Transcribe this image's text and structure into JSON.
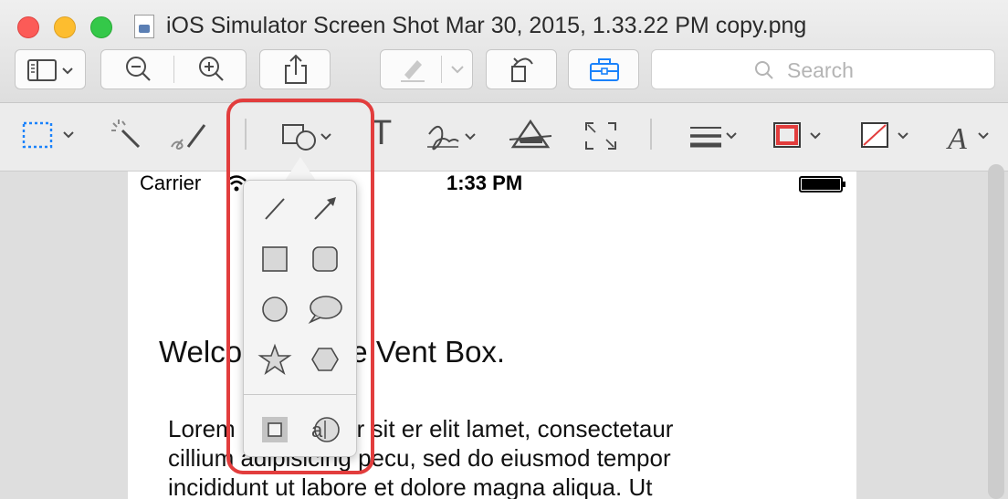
{
  "window": {
    "title": "iOS Simulator Screen Shot Mar 30, 2015, 1.33.22 PM copy.png"
  },
  "toolbar": {
    "search_placeholder": "Search",
    "items": [
      "sidebar-view",
      "zoom-out",
      "zoom-in",
      "share",
      "markup-toggle",
      "rotate",
      "toolbox"
    ]
  },
  "markup_toolbar": {
    "tools": [
      "rectangular-selection",
      "instant-alpha",
      "sketch",
      "shapes",
      "text",
      "sign",
      "adjust-color",
      "adjust-size",
      "shape-style",
      "border-color",
      "fill-color",
      "text-style"
    ],
    "text_tool_label": "T"
  },
  "shapes_popover": {
    "items": [
      "line",
      "arrow",
      "square",
      "rounded-square",
      "circle",
      "speech-bubble",
      "star",
      "hexagon",
      "mask",
      "loupe"
    ]
  },
  "document": {
    "status_bar": {
      "carrier": "Carrier",
      "time": "1:33 PM"
    },
    "heading": "Welcome to the Vent Box.",
    "body_lines": [
      "Lorem ipsum dolor sit er elit lamet, consectetaur",
      "cillium adipisicing pecu, sed do eiusmod tempor",
      "incididunt ut labore et dolore magna aliqua. Ut"
    ]
  },
  "colors": {
    "highlight": "#e23d3d",
    "accent": "#1a82fb",
    "border_swatch": "#e23d3d"
  }
}
